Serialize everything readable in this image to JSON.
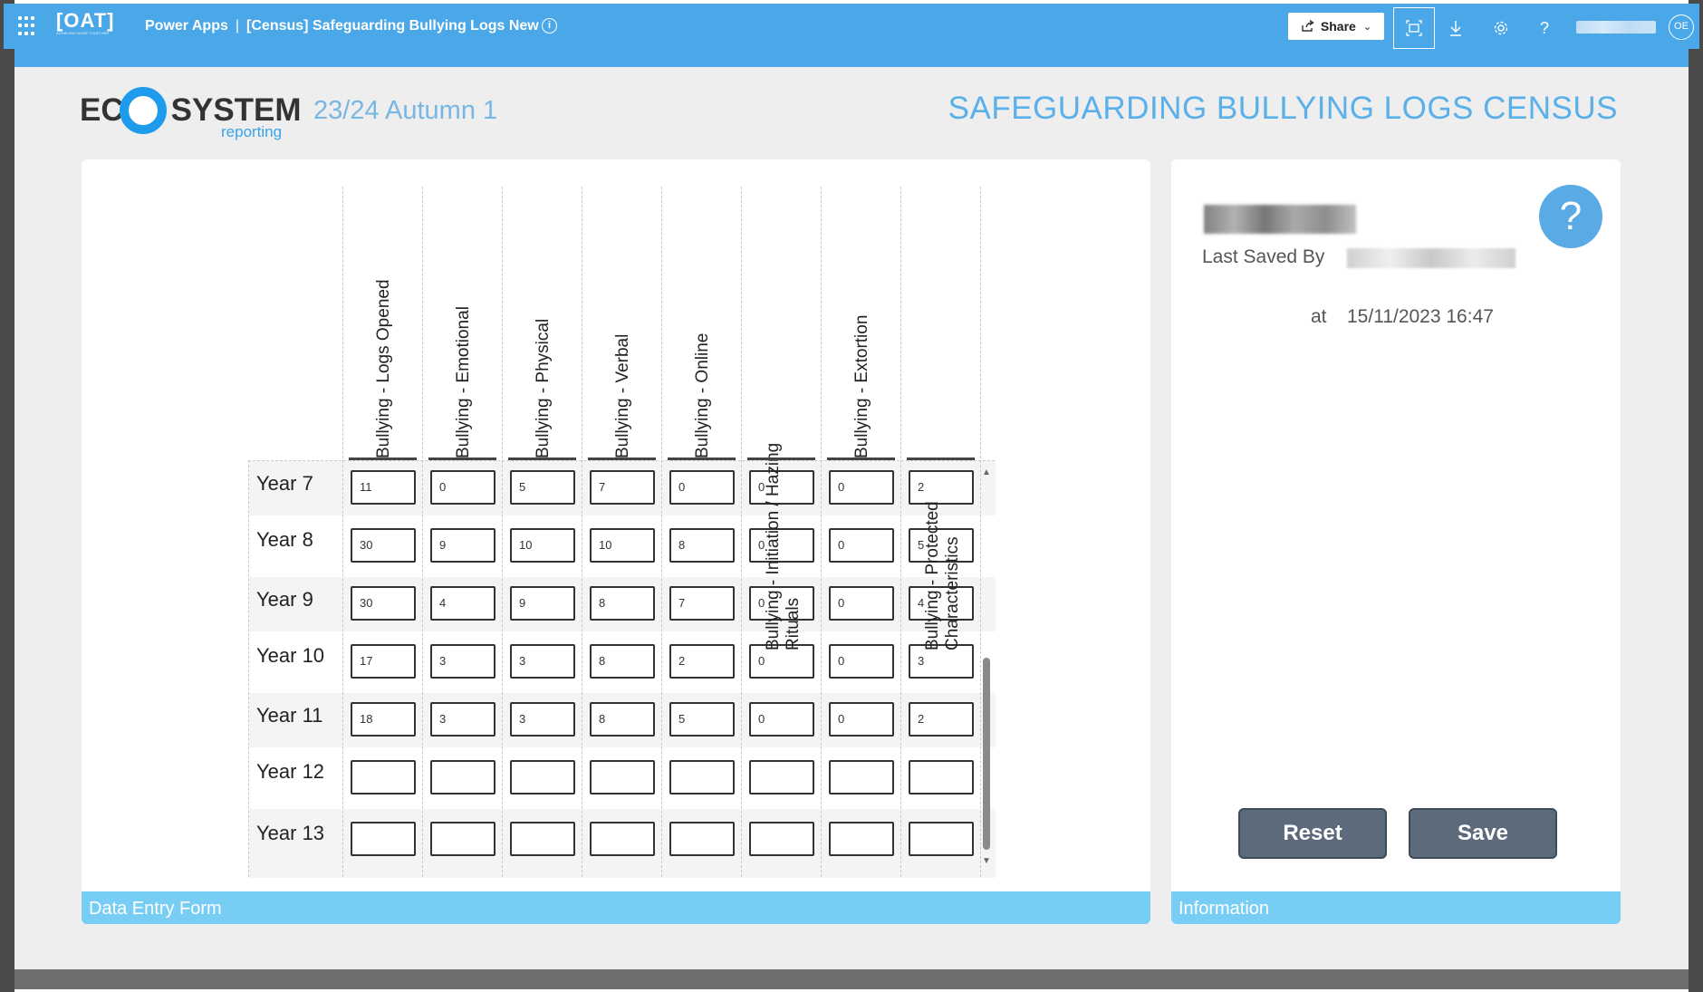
{
  "topbar": {
    "org_logo": "[OAT]",
    "org_tagline": "ACHIEVING MORE TOGETHER",
    "app_name": "Power Apps",
    "separator": "|",
    "doc_title": "[Census] Safeguarding Bullying Logs New",
    "share_label": "Share",
    "avatar_initials": "OE",
    "icons": [
      "waffle-icon",
      "info-icon",
      "share-icon",
      "fit-screen-icon",
      "download-icon",
      "gear-icon",
      "help-icon"
    ]
  },
  "header": {
    "logo_text_left": "EC",
    "logo_text_right": "SYSTEM",
    "logo_sub": "reporting",
    "period": "23/24 Autumn 1",
    "title": "SAFEGUARDING BULLYING LOGS CENSUS"
  },
  "form": {
    "footer_label": "Data Entry Form",
    "columns": [
      "Bullying - Logs Opened",
      "Bullying - Emotional",
      "Bullying - Physical",
      "Bullying - Verbal",
      "Bullying - Online",
      "Bullying - Initiation / Hazing Rituals",
      "Bullying - Extortion",
      "Bullying - Protected Characteristics"
    ],
    "rows": [
      {
        "label": "Year 7",
        "values": [
          "11",
          "0",
          "5",
          "7",
          "0",
          "0",
          "0",
          "2"
        ]
      },
      {
        "label": "Year 8",
        "values": [
          "30",
          "9",
          "10",
          "10",
          "8",
          "0",
          "0",
          "5"
        ]
      },
      {
        "label": "Year 9",
        "values": [
          "30",
          "4",
          "9",
          "8",
          "7",
          "0",
          "0",
          "4"
        ]
      },
      {
        "label": "Year 10",
        "values": [
          "17",
          "3",
          "3",
          "8",
          "2",
          "0",
          "0",
          "3"
        ]
      },
      {
        "label": "Year 11",
        "values": [
          "18",
          "3",
          "3",
          "8",
          "5",
          "0",
          "0",
          "2"
        ]
      },
      {
        "label": "Year 12",
        "values": [
          "",
          "",
          "",
          "",
          "",
          "",
          "",
          ""
        ]
      },
      {
        "label": "Year 13",
        "values": [
          "",
          "",
          "",
          "",
          "",
          "",
          "",
          ""
        ]
      }
    ]
  },
  "info": {
    "footer_label": "Information",
    "last_saved_label": "Last Saved By",
    "at_label": "at",
    "saved_at": "15/11/2023 16:47",
    "help_glyph": "?",
    "reset_label": "Reset",
    "save_label": "Save"
  }
}
